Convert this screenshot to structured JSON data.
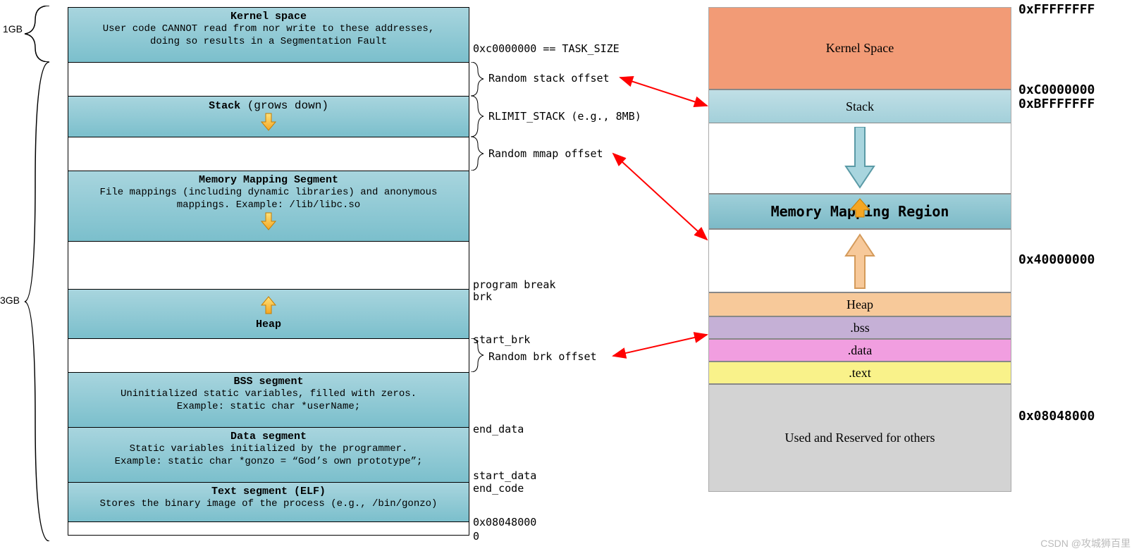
{
  "left": {
    "size1": "1GB",
    "size3": "3GB",
    "kernel": {
      "title": "Kernel space",
      "desc": "User code CANNOT read from nor write to these addresses,\ndoing so results in a Segmentation Fault"
    },
    "stack": {
      "title": "Stack",
      "suffix": " (grows down)"
    },
    "mms": {
      "title": "Memory Mapping Segment",
      "desc": "File mappings (including dynamic libraries) and anonymous\nmappings. Example: /lib/libc.so"
    },
    "heap": {
      "title": "Heap"
    },
    "bss": {
      "title": "BSS segment",
      "desc": "Uninitialized static variables, filled with zeros.\nExample: static char *userName;"
    },
    "data": {
      "title": "Data segment",
      "desc": "Static variables initialized by the programmer.\nExample: static char *gonzo = “God’s own prototype”;"
    },
    "text": {
      "title": "Text segment (ELF)",
      "desc": "Stores the binary image of the process (e.g., /bin/gonzo)"
    }
  },
  "labels": {
    "tasksize": "0xc0000000 == TASK_SIZE",
    "randstack": "Random stack offset",
    "rlimit": "RLIMIT_STACK (e.g., 8MB)",
    "randmmap": "Random mmap offset",
    "progbrk": "program break",
    "brk": "brk",
    "startbrk": "start_brk",
    "randbrk": "Random brk offset",
    "enddata": "end_data",
    "startdata": "start_data",
    "endcode": "end_code",
    "addr08": "0x08048000",
    "zero": "0"
  },
  "right": {
    "kernel": "Kernel Space",
    "stack": "Stack",
    "mmr": "Memory Mapping Region",
    "heap": "Heap",
    "bss": ".bss",
    "data": ".data",
    "text": ".text",
    "reserved": "Used and Reserved for others"
  },
  "addr": {
    "ff": "0xFFFFFFFF",
    "c0": "0xC0000000",
    "bf": "0xBFFFFFFF",
    "x40": "0x40000000",
    "x08": "0x08048000"
  },
  "watermark": "CSDN @攻城狮百里"
}
